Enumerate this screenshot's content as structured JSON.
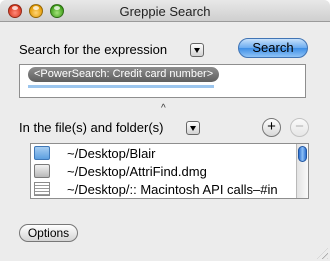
{
  "window": {
    "title": "Greppie Search"
  },
  "search": {
    "label": "Search for the expression",
    "button_label": "Search",
    "expression_token": "<PowerSearch: Credit card number>"
  },
  "files": {
    "label": "In the file(s) and folder(s)",
    "add_label": "+",
    "remove_label": "−",
    "items": [
      {
        "path": "~/Desktop/Blair",
        "icon": "folder-icon"
      },
      {
        "path": "~/Desktop/AttriFind.dmg",
        "icon": "disk-image-icon"
      },
      {
        "path": "~/Desktop/:: Macintosh API calls–#in",
        "icon": "document-icon"
      }
    ]
  },
  "footer": {
    "options_label": "Options"
  },
  "colors": {
    "accent": "#3d8ee6",
    "token_bg": "#6e6e6e",
    "window_bg": "#ececec"
  }
}
